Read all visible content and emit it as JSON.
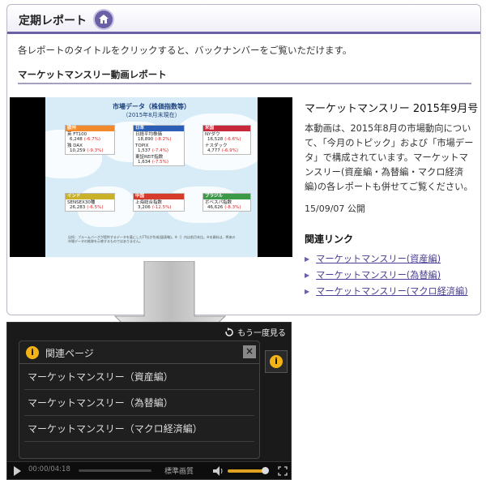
{
  "panel": {
    "title": "定期レポート",
    "intro": "各レポートのタイトルをクリックすると、バックナンバーをご覧いただけます。",
    "section_title": "マーケットマンスリー動画レポート"
  },
  "thumbnail": {
    "title": "市場データ（株価指数等）",
    "subtitle": "（2015年8月末現在）",
    "boxes": [
      {
        "region": "欧州",
        "color": "#f08a2c",
        "rows": [
          {
            "name": "英 FT100",
            "value": "6,248",
            "change": "(-6.7%)"
          },
          {
            "name": "独 DAX",
            "value": "10,259",
            "change": "(-9.3%)"
          }
        ]
      },
      {
        "region": "日本",
        "color": "#2b5fb5",
        "rows": [
          {
            "name": "日経平均株価",
            "value": "18,890",
            "change": "(-8.2%)"
          },
          {
            "name": "TOPIX",
            "value": "1,537",
            "change": "(-7.4%)"
          },
          {
            "name": "東証REIT指数",
            "value": "1,634",
            "change": "(-7.5%)"
          }
        ]
      },
      {
        "region": "米国",
        "color": "#c8283c",
        "rows": [
          {
            "name": "NYダウ",
            "value": "16,528",
            "change": "(-6.6%)"
          },
          {
            "name": "ナスダック",
            "value": "4,777",
            "change": "(-6.9%)"
          }
        ]
      },
      {
        "region": "インド",
        "color": "#c9b22a",
        "rows": [
          {
            "name": "SENSEX30種",
            "value": "26,283",
            "change": "(-6.5%)"
          }
        ]
      },
      {
        "region": "中国",
        "color": "#d63a2a",
        "rows": [
          {
            "name": "上海総合指数",
            "value": "3,206",
            "change": "(-12.5%)"
          }
        ]
      },
      {
        "region": "ブラジル",
        "color": "#3a9a48",
        "rows": [
          {
            "name": "ボベスパ指数",
            "value": "46,626",
            "change": "(-8.3%)"
          }
        ]
      }
    ],
    "note": "出所：ブルームバーグが提供するデータを基にしたFT社が作成(図表略)。※（）内は前月末比。※本資料は、将来の市場データの推移を示唆するものではありません。"
  },
  "video": {
    "title": "マーケットマンスリー 2015年9月号",
    "description": "本動画は、2015年8月の市場動向について、「今月のトピック」および「市場データ」で構成されています。マーケットマンスリー(資産編・為替編・マクロ経済編)の各レポートも併せてご覧ください。",
    "date": "15/09/07 公開"
  },
  "related": {
    "heading": "関連リンク",
    "links": [
      "マーケットマンスリー(資産編)",
      "マーケットマンスリー(為替編)",
      "マーケットマンスリー(マクロ経済編)"
    ]
  },
  "player": {
    "replay_label": "もう一度見る",
    "panel_title": "関連ページ",
    "info_glyph": "i",
    "close_glyph": "×",
    "items": [
      "マーケットマンスリー（資産編）",
      "マーケットマンスリー（為替編）",
      "マーケットマンスリー（マクロ経済編）"
    ],
    "time": "00:00/04:18",
    "quality": "標準画質"
  },
  "colors": {
    "accent": "#6b5fa6",
    "link": "#4a3f96",
    "info": "#f2b316",
    "volume": "#e0a020"
  },
  "icons": [
    "building-icon",
    "replay-icon",
    "info-icon",
    "close-icon",
    "play-icon",
    "volume-icon",
    "fullscreen-icon",
    "down-arrow-icon"
  ]
}
